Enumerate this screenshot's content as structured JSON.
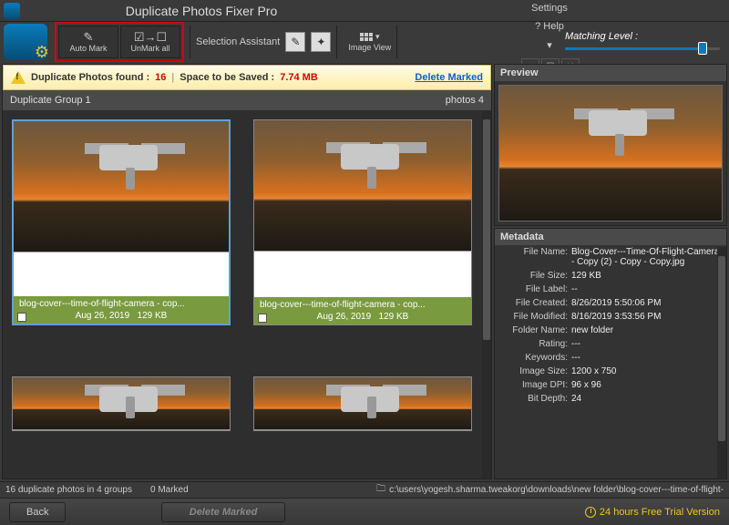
{
  "titlebar": {
    "title": "Duplicate Photos Fixer Pro",
    "settings": "Settings",
    "help": "? Help"
  },
  "toolbar": {
    "auto_mark": "Auto Mark",
    "unmark_all": "UnMark all",
    "selection_assistant": "Selection Assistant",
    "image_view": "Image View",
    "matching_level": "Matching Level :"
  },
  "infobar": {
    "dup_label": "Duplicate Photos found :",
    "dup_count": "16",
    "space_label": "Space to be Saved :",
    "space_value": "7.74 MB",
    "delete_marked": "Delete Marked"
  },
  "group": {
    "name": "Duplicate Group 1",
    "count_label": "photos 4"
  },
  "thumbs": [
    {
      "filename": "blog-cover---time-of-flight-camera - cop...",
      "date": "Aug 26, 2019",
      "size": "129 KB"
    },
    {
      "filename": "blog-cover---time-of-flight-camera - cop...",
      "date": "Aug 26, 2019",
      "size": "129 KB"
    }
  ],
  "preview": {
    "header": "Preview"
  },
  "metadata": {
    "header": "Metadata",
    "rows": [
      {
        "k": "File Name:",
        "v": "Blog-Cover---Time-Of-Flight-Camera - Copy (2) - Copy - Copy.jpg"
      },
      {
        "k": "File Size:",
        "v": "129 KB"
      },
      {
        "k": "File Label:",
        "v": "--"
      },
      {
        "k": "File Created:",
        "v": "8/26/2019 5:50:06 PM"
      },
      {
        "k": "File Modified:",
        "v": "8/16/2019 3:53:56 PM"
      },
      {
        "k": "Folder Name:",
        "v": "new folder"
      },
      {
        "k": "Rating:",
        "v": "---"
      },
      {
        "k": "Keywords:",
        "v": "---"
      },
      {
        "k": "Image Size:",
        "v": "1200 x 750"
      },
      {
        "k": "Image DPI:",
        "v": "96 x 96"
      },
      {
        "k": "Bit Depth:",
        "v": "24"
      }
    ]
  },
  "status": {
    "summary": "16 duplicate photos in 4 groups",
    "marked": "0 Marked",
    "path": "c:\\users\\yogesh.sharma.tweakorg\\downloads\\new folder\\blog-cover---time-of-flight-"
  },
  "footer": {
    "back": "Back",
    "delete": "Delete Marked",
    "trial": "24 hours Free Trial Version"
  }
}
